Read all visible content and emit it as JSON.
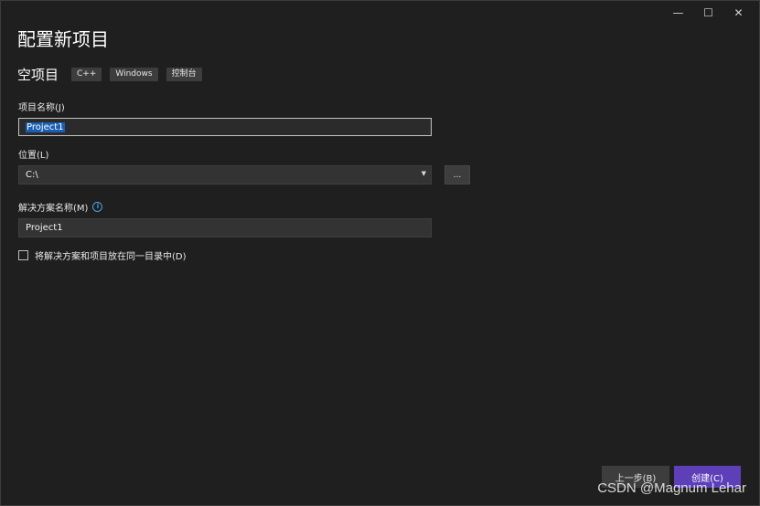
{
  "window": {
    "controls": {
      "minimize": "—",
      "maximize": "☐",
      "close": "✕"
    }
  },
  "header": {
    "title": "配置新项目"
  },
  "template": {
    "name": "空项目",
    "tags": [
      "C++",
      "Windows",
      "控制台"
    ]
  },
  "form": {
    "project_name": {
      "label": "项目名称(J)",
      "value": "Project1"
    },
    "location": {
      "label": "位置(L)",
      "value": "C:\\",
      "browse_label": "..."
    },
    "solution_name": {
      "label": "解决方案名称(M)",
      "value": "Project1"
    },
    "same_dir_checkbox": {
      "label": "将解决方案和项目放在同一目录中(D)",
      "checked": false
    }
  },
  "footer": {
    "back_label": "上一步(B)",
    "create_label": "创建(C)"
  },
  "watermark": "CSDN @Magnum Lehar",
  "colors": {
    "background": "#1f1f1f",
    "accent": "#5d3fb8",
    "selection": "#1b5fb3",
    "info": "#4aa3df"
  }
}
